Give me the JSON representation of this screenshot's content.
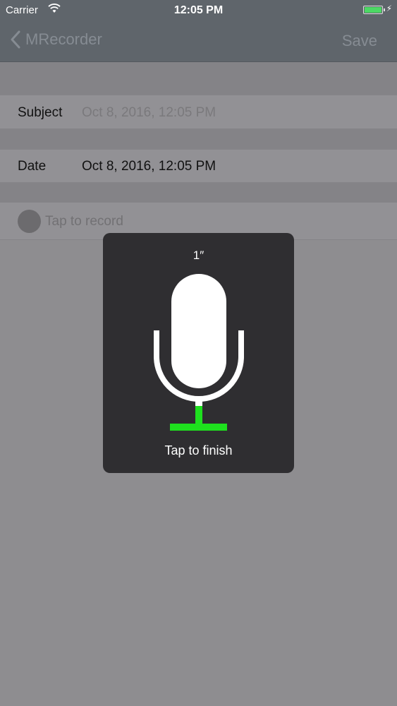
{
  "status_bar": {
    "carrier": "Carrier",
    "time": "12:05 PM",
    "battery_color": "#4cd964"
  },
  "nav": {
    "back_label": "MRecorder",
    "save_label": "Save"
  },
  "form": {
    "subject_label": "Subject",
    "subject_placeholder": "Oct 8, 2016, 12:05 PM",
    "date_label": "Date",
    "date_value": "Oct 8, 2016, 12:05 PM",
    "record_label": "Tap to record"
  },
  "recorder_hud": {
    "elapsed": "1″",
    "finish_label": "Tap to finish",
    "level_color": "#1ee01e",
    "mic_icon": "microphone-icon",
    "level_fraction": 0.15
  }
}
